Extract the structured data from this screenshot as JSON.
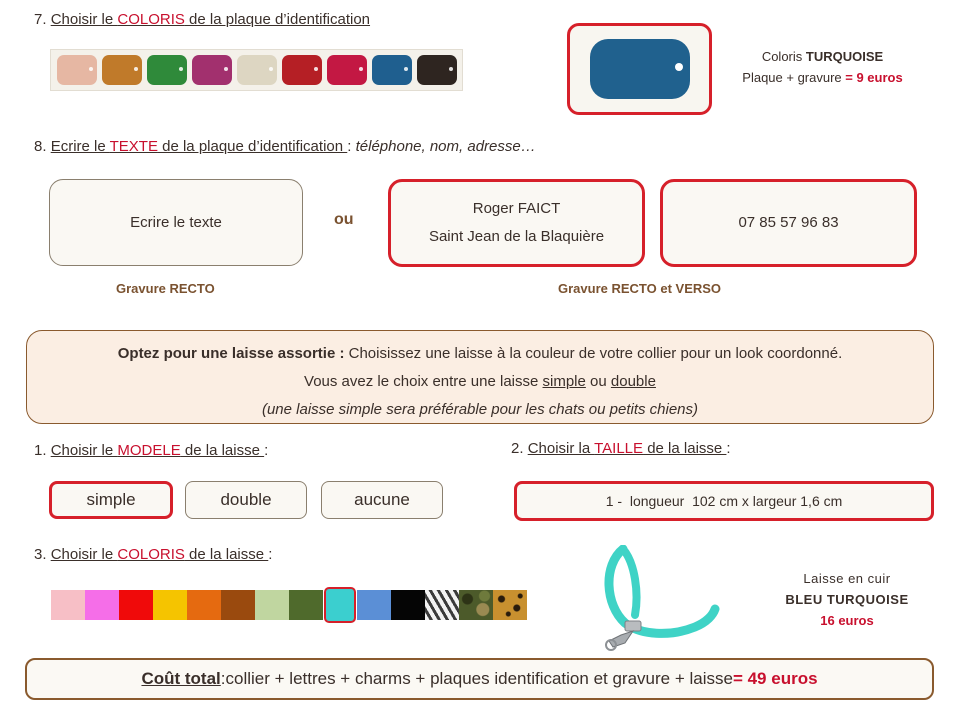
{
  "plate_section": {
    "number": "7.",
    "title_pre": "Choisir le ",
    "title_key": "COLORIS",
    "title_post": " de la plaque d’identification",
    "swatches": [
      {
        "name": "rose",
        "color": "#e6b7a3"
      },
      {
        "name": "caramel",
        "color": "#c07a2a"
      },
      {
        "name": "vert",
        "color": "#2f8a3a"
      },
      {
        "name": "fuchsia",
        "color": "#a2306e"
      },
      {
        "name": "beige",
        "color": "#ddd6c2"
      },
      {
        "name": "rouge",
        "color": "#b51f25"
      },
      {
        "name": "framboise",
        "color": "#c31843"
      },
      {
        "name": "turquoise",
        "color": "#1f5f8f"
      },
      {
        "name": "noir",
        "color": "#2e2520"
      }
    ],
    "selected_color": "#20618e",
    "info_label": "Coloris ",
    "info_color_name": "TURQUOISE",
    "info_price_label": "Plaque + gravure ",
    "info_price": "= 9 euros"
  },
  "text_section": {
    "number": "8.",
    "title_pre": "Ecrire le ",
    "title_key": "TEXTE",
    "title_post": " de la plaque d’identification ",
    "title_colon": ":",
    "hint": " téléphone, nom, adresse…",
    "recto_placeholder": "Ecrire le texte",
    "or_label": "ou",
    "recto_line1": "Roger FAICT",
    "recto_line2": "Saint Jean de la Blaquière",
    "verso_text": "07 85 57 96 83",
    "caption_recto": "Gravure RECTO",
    "caption_recto_verso": "Gravure RECTO et VERSO"
  },
  "leash_offer": {
    "lead_bold": "Optez pour une laisse assortie :",
    "lead_text": " Choisissez une laisse à la couleur de votre collier pour un look coordonné.",
    "line2_pre": "Vous avez le choix entre une laisse ",
    "line2_simple": "simple",
    "line2_mid": " ou ",
    "line2_double": "double",
    "line3": "(une laisse simple sera  préférable pour les chats ou petits chiens)"
  },
  "model_section": {
    "number": "1.",
    "title_pre": "Choisir le ",
    "title_key": "MODELE",
    "title_post": " de la laisse ",
    "title_colon": ":",
    "options": [
      "simple",
      "double",
      "aucune"
    ],
    "selected": "simple"
  },
  "size_section": {
    "number": "2.",
    "title_pre": "Choisir la ",
    "title_key": "TAILLE",
    "title_post": " de la laisse ",
    "title_colon": ":",
    "selected_value": "1 -  longueur  102 cm x largeur 1,6 cm"
  },
  "leash_color_section": {
    "number": "3.",
    "title_pre": "Choisir le ",
    "title_key": "COLORIS",
    "title_post": " de la laisse ",
    "title_colon": ":",
    "swatches": [
      {
        "name": "rose-pale",
        "color": "#f7bfc6"
      },
      {
        "name": "rose-vif",
        "color": "#f56ee8"
      },
      {
        "name": "rouge",
        "color": "#f00a0a"
      },
      {
        "name": "jaune",
        "color": "#f5c400"
      },
      {
        "name": "orange",
        "color": "#e56a10"
      },
      {
        "name": "marron",
        "color": "#9a4a0e"
      },
      {
        "name": "vert-clair",
        "color": "#c0d6a0"
      },
      {
        "name": "vert-olive",
        "color": "#4f6a2c"
      },
      {
        "name": "turquoise",
        "color": "#3bcfcf"
      },
      {
        "name": "bleu",
        "color": "#5b8fd6"
      },
      {
        "name": "noir",
        "color": "#050505"
      },
      {
        "name": "zebre",
        "color": "#888888"
      },
      {
        "name": "camouflage",
        "color": "#4c5a2a"
      },
      {
        "name": "leopard",
        "color": "#c8902f"
      }
    ],
    "selected": "turquoise",
    "leash_color": "#3fd3c6",
    "info_line1": "Laisse en cuir",
    "info_line2": "BLEU TURQUOISE",
    "info_line3": "16 euros"
  },
  "total": {
    "label": "Coût total",
    "colon": " :",
    "items": " collier + lettres + charms + plaques identification et gravure + laisse ",
    "amount": "= 49 euros"
  },
  "colors": {
    "accent_red": "#d6202a",
    "text_red": "#c8102e",
    "brown_border": "#8a5a2e"
  }
}
